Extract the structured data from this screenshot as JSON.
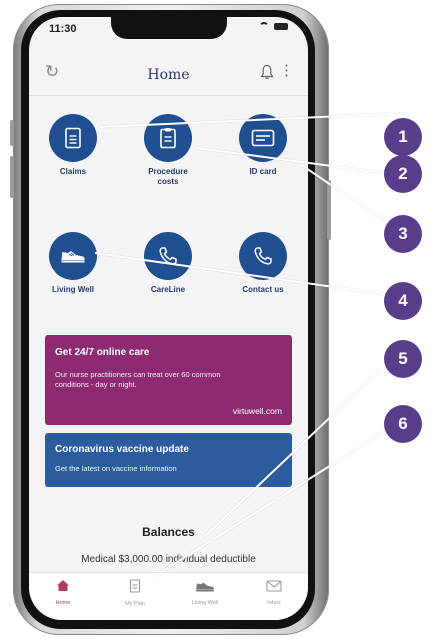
{
  "status": {
    "time": "11:30"
  },
  "header": {
    "title": "Home"
  },
  "tiles": [
    {
      "label": "Claims",
      "icon": "document-icon"
    },
    {
      "label": "Procedure costs",
      "icon": "clipboard-icon"
    },
    {
      "label": "ID card",
      "icon": "id-card-icon"
    },
    {
      "label": "Living Well",
      "icon": "sneaker-icon"
    },
    {
      "label": "CareLine",
      "icon": "phone-icon"
    },
    {
      "label": "Contact us",
      "icon": "phone-icon"
    }
  ],
  "cards": {
    "online_care": {
      "title": "Get 24/7 online care",
      "text": "Our nurse practitioners can treat over 60 common conditions - day or night.",
      "link": "virtuwell.com",
      "color": "#8e2a72"
    },
    "vaccine": {
      "title": "Coronavirus vaccine update",
      "text": "Get the latest on vaccine information",
      "color": "#2d5c9e"
    }
  },
  "balances": {
    "title": "Balances",
    "line": "Medical $3,000.00 individual deductible"
  },
  "tabbar": {
    "items": [
      {
        "label": "Home",
        "icon": "home-icon",
        "active": true
      },
      {
        "label": "My Plan",
        "icon": "plan-icon",
        "active": false
      },
      {
        "label": "Living Well",
        "icon": "sneaker-icon",
        "active": false
      },
      {
        "label": "Inbox",
        "icon": "mail-icon",
        "active": false
      }
    ]
  },
  "callouts": [
    "1",
    "2",
    "3",
    "4",
    "5",
    "6"
  ],
  "colors": {
    "primary": "#1f4f91",
    "badge": "#5a3d8a",
    "accent": "#b23a6a"
  }
}
